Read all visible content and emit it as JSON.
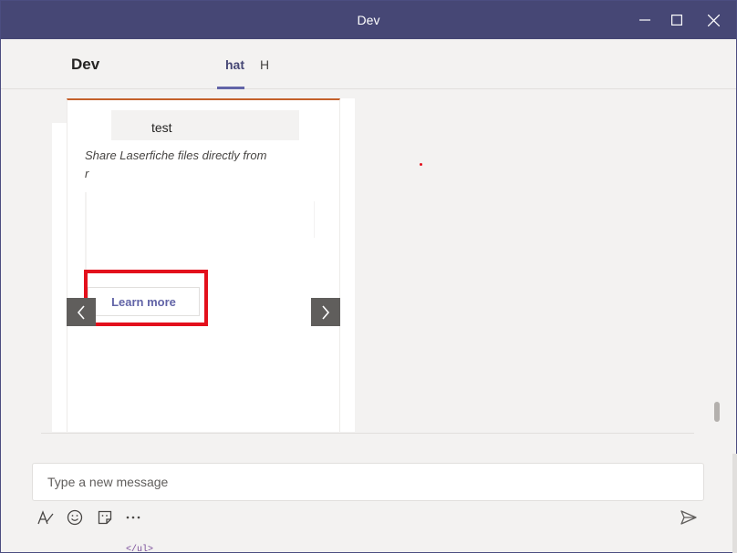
{
  "window": {
    "title": "Dev"
  },
  "header": {
    "channel_name": "Dev",
    "tabs": [
      {
        "label": "hat",
        "active": true
      },
      {
        "label": "H",
        "active": false
      }
    ]
  },
  "card": {
    "title": "test",
    "description_line1": "Share Laserfiche files directly from",
    "description_line2": "r",
    "button_label": "Learn more",
    "accent_color": "#c4612b"
  },
  "compose": {
    "placeholder": "Type a new message"
  },
  "toolbar": {
    "format_icon": "format-icon",
    "emoji_icon": "emoji-icon",
    "sticker_icon": "sticker-icon",
    "more_icon": "more-icon",
    "send_icon": "send-icon"
  },
  "colors": {
    "titlebar": "#464775",
    "accent": "#6264a7",
    "highlight": "#e3101c"
  },
  "fragment": "</ul>"
}
